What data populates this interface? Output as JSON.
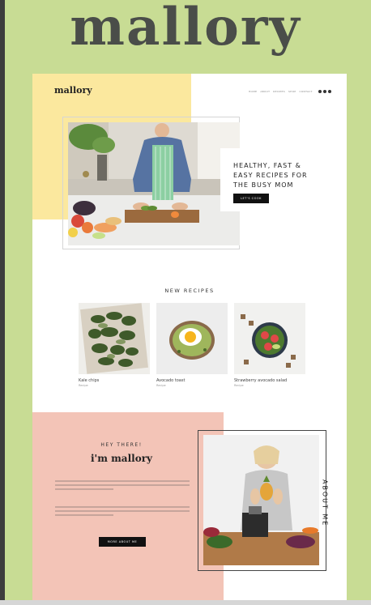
{
  "brand_title": "mallory",
  "header": {
    "logo": "mallory",
    "nav": [
      "HOME",
      "ABOUT",
      "RECIPES",
      "SHOP",
      "CONTACT"
    ]
  },
  "hero": {
    "headline": "HEALTHY, FAST & EASY RECIPES FOR THE BUSY MOM",
    "cta": "LET'S COOK"
  },
  "recipes_section": {
    "title": "NEW RECIPES",
    "items": [
      {
        "name": "Kale chips",
        "meta": "Recipe"
      },
      {
        "name": "Avocado toast",
        "meta": "Recipe"
      },
      {
        "name": "Strawberry avocado salad",
        "meta": "Recipe"
      }
    ]
  },
  "about": {
    "greeting": "HEY THERE!",
    "title": "i'm mallory",
    "cta": "MORE ABOUT ME",
    "vertical_label": "ABOUT ME"
  },
  "colors": {
    "background": "#c8dc94",
    "yellow": "#fbe89e",
    "pink": "#f3c4b7",
    "dark": "#111111"
  }
}
